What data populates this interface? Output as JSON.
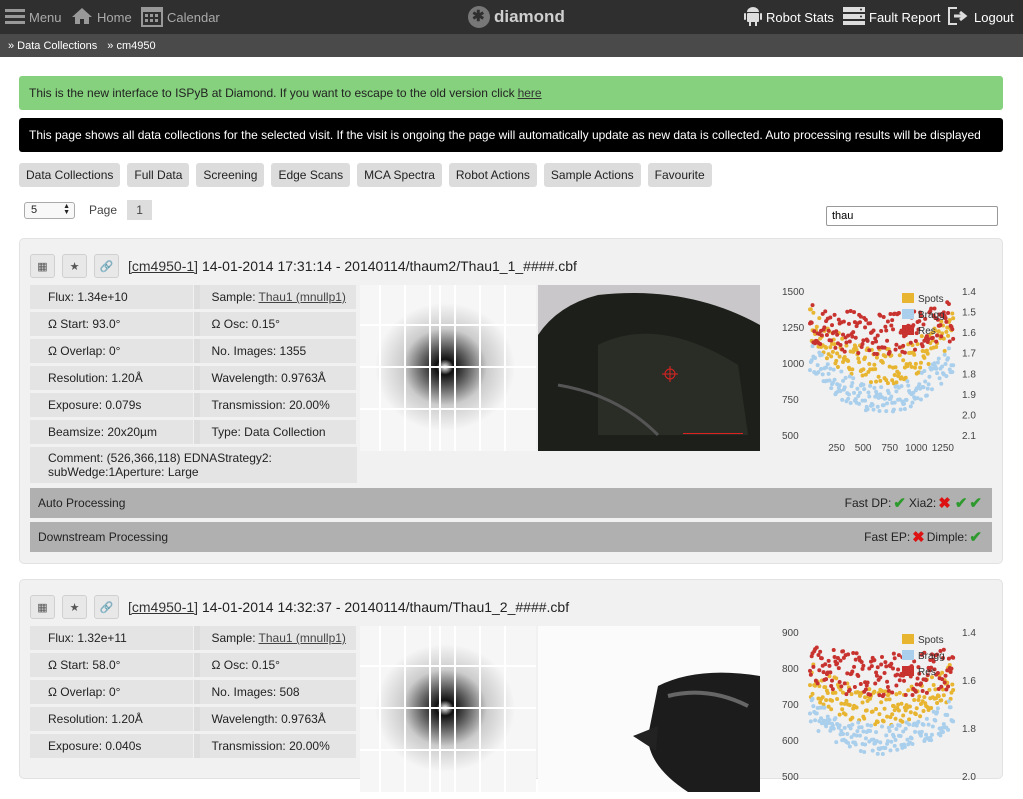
{
  "nav": {
    "menu": "Menu",
    "home": "Home",
    "calendar": "Calendar",
    "logo": "diamond",
    "robot_stats": "Robot Stats",
    "fault_report": "Fault Report",
    "logout": "Logout"
  },
  "breadcrumb": [
    "» Data Collections",
    "» cm4950"
  ],
  "messages": {
    "green": "This is the new interface to ISPyB at Diamond. If you want to escape to the old version click",
    "green_link": "here",
    "black": "This page shows all data collections for the selected visit. If the visit is ongoing the page will automatically update as new data is collected. Auto processing results will be displayed"
  },
  "tabs": [
    "Data Collections",
    "Full Data",
    "Screening",
    "Edge Scans",
    "MCA Spectra",
    "Robot Actions",
    "Sample Actions",
    "Favourite"
  ],
  "pager": {
    "per_page": "5",
    "label": "Page",
    "current": "1"
  },
  "search": {
    "value": "thau"
  },
  "collections": [
    {
      "visit": "[cm4950-1]",
      "title": "14-01-2014 17:31:14 - 20140114/thaum2/Thau1_1_####.cbf",
      "left": [
        "Flux: 1.34e+10",
        "Ω Start: 93.0°",
        "Ω Overlap: 0°",
        "Resolution: 1.20Å",
        "Exposure: 0.079s",
        "Beamsize: 20x20µm"
      ],
      "right": [
        "Sample:",
        "Ω Osc: 0.15°",
        "No. Images: 1355",
        "Wavelength: 0.9763Å",
        "Transmission: 20.00%",
        "Type: Data Collection"
      ],
      "sample_link": "Thau1 (mnullp1)",
      "comment": "Comment:  (526,366,118) EDNAStrategy2: subWedge:1Aperture: Large",
      "auto_label": "Auto Processing",
      "auto_status": [
        "Fast DP:",
        "Xia2:"
      ],
      "down_label": "Downstream Processing",
      "down_status": [
        "Fast EP:",
        "Dimple:"
      ]
    },
    {
      "visit": "[cm4950-1]",
      "title": "14-01-2014 14:32:37 - 20140114/thaum/Thau1_2_####.cbf",
      "left": [
        "Flux: 1.32e+11",
        "Ω Start: 58.0°",
        "Ω Overlap: 0°",
        "Resolution: 1.20Å",
        "Exposure: 0.040s"
      ],
      "right": [
        "Sample:",
        "Ω Osc: 0.15°",
        "No. Images: 508",
        "Wavelength: 0.9763Å",
        "Transmission: 20.00%"
      ],
      "sample_link": "Thau1 (mnullp1)"
    }
  ],
  "chart_data": [
    {
      "type": "scatter",
      "x_ticks": [
        250,
        500,
        750,
        1000,
        1250
      ],
      "y_ticks": [
        500,
        750,
        1000,
        1250,
        1500
      ],
      "y2_ticks": [
        1.4,
        1.5,
        1.6,
        1.7,
        1.8,
        1.9,
        2.0,
        2.1
      ],
      "xlim": [
        0,
        1355
      ],
      "ylim": [
        500,
        1500
      ],
      "y2lim": [
        1.4,
        2.1
      ],
      "legend": "top-right",
      "series": [
        {
          "name": "Spots",
          "color": "#e8b531"
        },
        {
          "name": "Bragg",
          "color": "#a9cfec"
        },
        {
          "name": "Res",
          "color": "#c8322f"
        }
      ]
    },
    {
      "type": "scatter",
      "y_ticks": [
        500,
        600,
        700,
        800,
        900
      ],
      "y2_ticks": [
        1.4,
        1.6,
        1.8,
        2.0
      ],
      "xlim": [
        0,
        508
      ],
      "ylim": [
        500,
        900
      ],
      "y2lim": [
        1.4,
        2.0
      ],
      "legend": "top-right",
      "series": [
        {
          "name": "Spots",
          "color": "#e8b531"
        },
        {
          "name": "Bragg",
          "color": "#a9cfec"
        },
        {
          "name": "Res",
          "color": "#c8322f"
        }
      ]
    }
  ]
}
